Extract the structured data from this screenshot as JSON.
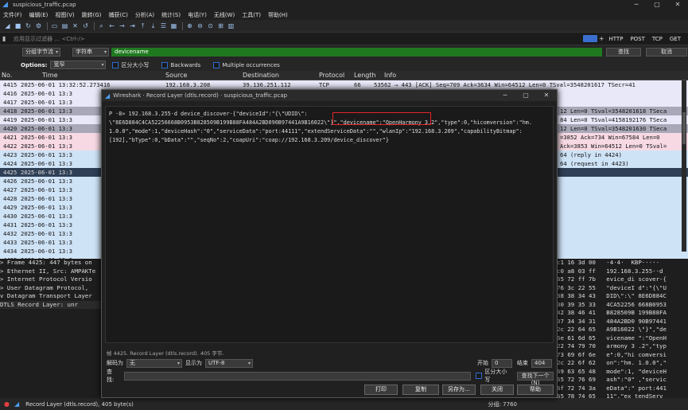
{
  "window": {
    "title": "suspicious_traffic.pcap",
    "min": "─",
    "max": "▢",
    "close": "✕"
  },
  "menu": [
    "文件(F)",
    "编辑(E)",
    "视图(V)",
    "跳转(G)",
    "捕获(C)",
    "分析(A)",
    "统计(S)",
    "电话(Y)",
    "无线(W)",
    "工具(T)",
    "帮助(H)"
  ],
  "filter": {
    "placeholder": "应用显示过滤器 … <Ctrl-/>",
    "buttons": [
      "HTTP",
      "POST",
      "TCP",
      "GET"
    ],
    "plus": "+"
  },
  "search": {
    "scope": "分组字节流",
    "type": "字符串",
    "value": "devicename",
    "find": "查找",
    "cancel": "取消"
  },
  "options": {
    "label": "Options:",
    "charset": "宽窄",
    "case": "区分大小写",
    "backwards": "Backwards",
    "multiple": "Multiple occurrences"
  },
  "columns": [
    "No.",
    "Time",
    "Source",
    "Destination",
    "Protocol",
    "Length",
    "Info"
  ],
  "packets": [
    {
      "no": "4415",
      "time": "2025-06-01 13:32:52.273416",
      "src": "192.168.3.208",
      "dst": "39.136.251.112",
      "proto": "TCP",
      "len": "66",
      "info": "53562 → 443 [ACK] Seq=709 Ack=3634 Win=64512 Len=0 TSval=3548201617 TSecr=41"
    },
    {
      "no": "4416",
      "time": "2025-06-01 13:3",
      "src": "",
      "dst": "",
      "proto": "",
      "len": "",
      "info": ""
    },
    {
      "no": "4417",
      "time": "2025-06-01 13:3",
      "src": "",
      "dst": "",
      "proto": "",
      "len": "",
      "info": ""
    },
    {
      "no": "4418",
      "time": "2025-06-01 13:3",
      "src": "",
      "dst": "",
      "proto": "",
      "len": "",
      "info": "12 Len=0 TSval=3548201618 TSeca"
    },
    {
      "no": "4419",
      "time": "2025-06-01 13:3",
      "src": "",
      "dst": "",
      "proto": "",
      "len": "",
      "info": "84 Len=0 TSval=4158192176 TSeca"
    },
    {
      "no": "4420",
      "time": "2025-06-01 13:3",
      "src": "",
      "dst": "",
      "proto": "",
      "len": "",
      "info": "12 Len=0 TSval=3548201630 TSeca"
    },
    {
      "no": "4421",
      "time": "2025-06-01 13:3",
      "src": "",
      "dst": "",
      "proto": "",
      "len": "",
      "info": "=3852 Ack=734 Win=67584 Len=0"
    },
    {
      "no": "4422",
      "time": "2025-06-01 13:3",
      "src": "",
      "dst": "",
      "proto": "",
      "len": "",
      "info": "Ack=3853 Win=64512 Len=0 TSval="
    },
    {
      "no": "4423",
      "time": "2025-06-01 13:3",
      "src": "",
      "dst": "",
      "proto": "",
      "len": "",
      "info": "64 (reply in 4424)"
    },
    {
      "no": "4424",
      "time": "2025-06-01 13:3",
      "src": "",
      "dst": "",
      "proto": "",
      "len": "",
      "info": "64 (request in 4423)"
    },
    {
      "no": "4425",
      "time": "2025-06-01 13:3",
      "src": "",
      "dst": "",
      "proto": "",
      "len": "",
      "info": ""
    },
    {
      "no": "4426",
      "time": "2025-06-01 13:3",
      "src": "",
      "dst": "",
      "proto": "",
      "len": "",
      "info": ""
    },
    {
      "no": "4427",
      "time": "2025-06-01 13:3",
      "src": "",
      "dst": "",
      "proto": "",
      "len": "",
      "info": ""
    },
    {
      "no": "4428",
      "time": "2025-06-01 13:3",
      "src": "",
      "dst": "",
      "proto": "",
      "len": "",
      "info": ""
    },
    {
      "no": "4429",
      "time": "2025-06-01 13:3",
      "src": "",
      "dst": "",
      "proto": "",
      "len": "",
      "info": ""
    },
    {
      "no": "4430",
      "time": "2025-06-01 13:3",
      "src": "",
      "dst": "",
      "proto": "",
      "len": "",
      "info": ""
    },
    {
      "no": "4431",
      "time": "2025-06-01 13:3",
      "src": "",
      "dst": "",
      "proto": "",
      "len": "",
      "info": ""
    },
    {
      "no": "4432",
      "time": "2025-06-01 13:3",
      "src": "",
      "dst": "",
      "proto": "",
      "len": "",
      "info": ""
    },
    {
      "no": "4433",
      "time": "2025-06-01 13:3",
      "src": "",
      "dst": "",
      "proto": "",
      "len": "",
      "info": ""
    },
    {
      "no": "4434",
      "time": "2025-06-01 13:3",
      "src": "",
      "dst": "",
      "proto": "",
      "len": "",
      "info": ""
    },
    {
      "no": "4435",
      "time": "2025-06-01 13:3",
      "src": "",
      "dst": "",
      "proto": "",
      "len": "",
      "info": ""
    }
  ],
  "details": [
    "> Frame 4425: 447 bytes on",
    "> Ethernet II, Src: AMPAKTe",
    "> Internet Protocol Versio",
    "> User Datagram Protocol, ",
    "v Datagram Transport Layer",
    "    DTLS Record Layer: unr"
  ],
  "bytes": [
    "c1 16 3d 00   ·4·4·  KBP·····",
    "c0 a8 03 ff   192.168.3.255··d",
    "65 72 ff 7b   evice_di scover-{",
    "76 3c 22 55   \"deviceI d\":\"{\\\"U",
    "38 38 34 43   DID\\\":\\\" 8E6D884C",
    "30 39 35 33   4CA52256 668B0953",
    "42 38 46 41   B828509B 199B88FA",
    "37 34 34 31   484A2BD0 90B97441",
    "2c 22 64 65   A9B16022 \\\"}\",\"de",
    "6e 61 6d 65   vicename \":\"OpenH",
    "22 74 79 70   armony 3 .2\",\"typ",
    "73 69 6f 6e   e\":0,\"hi comversi",
    "2c 22 6f 62   on\":\"hm. 1.0.0\",\"",
    "69 63 65 48   mode\":1, \"deviceH",
    "65 72 76 69   ash\":\"0\" ,\"servic",
    "6f 72 74 3a   eData\":\" port:441",
    "65 78 74 65   11\",\"ex tendServ"
  ],
  "status": {
    "left": "Record Layer (dtls.record), 405 byte(s)",
    "right": "分组: 7760"
  },
  "dialog": {
    "title": "Wireshark · Record Layer (dtls.record) · suspicious_traffic.pcap",
    "lines": [
      "P ·8» 192.168.3.255·d device_discover·{\"deviceId\":\"{\\\"UDID\\\":",
      "\\\"8E6D884C4CA52256668B0953B828509B199B88FA484A2BD090B97441A9B16022\\\"}\",\"devicename\":\"OpenHarmony 3.2\",\"type\":0,\"hicomversion\":\"hm.",
      "1.0.0\",\"mode\":1,\"deviceHash\":\"0\",\"serviceData\":\"port:44111\",\"extendServiceData\":\"\",\"wlanIp\":\"192.168.3.209\",\"capabilityBitmap\":",
      "[192],\"bType\":0,\"bData\":\"\",\"seqNo\":2,\"coapUri\":\"coap://192.168.3.209/device_discover\"}"
    ],
    "note": "帧 4425. Record Layer (dtls.record). 405 字节.",
    "decode_label": "解码为",
    "decode_value": "无",
    "show_label": "显示为",
    "show_value": "UTF-8",
    "start_label": "开始",
    "start_value": "0",
    "end_label": "结束",
    "end_value": "404",
    "find_label": "查找:",
    "case_label": "区分大小写",
    "find_next": "查找下一个(N)",
    "buttons": [
      "打印",
      "复制",
      "另存为…",
      "关闭",
      "帮助"
    ]
  }
}
